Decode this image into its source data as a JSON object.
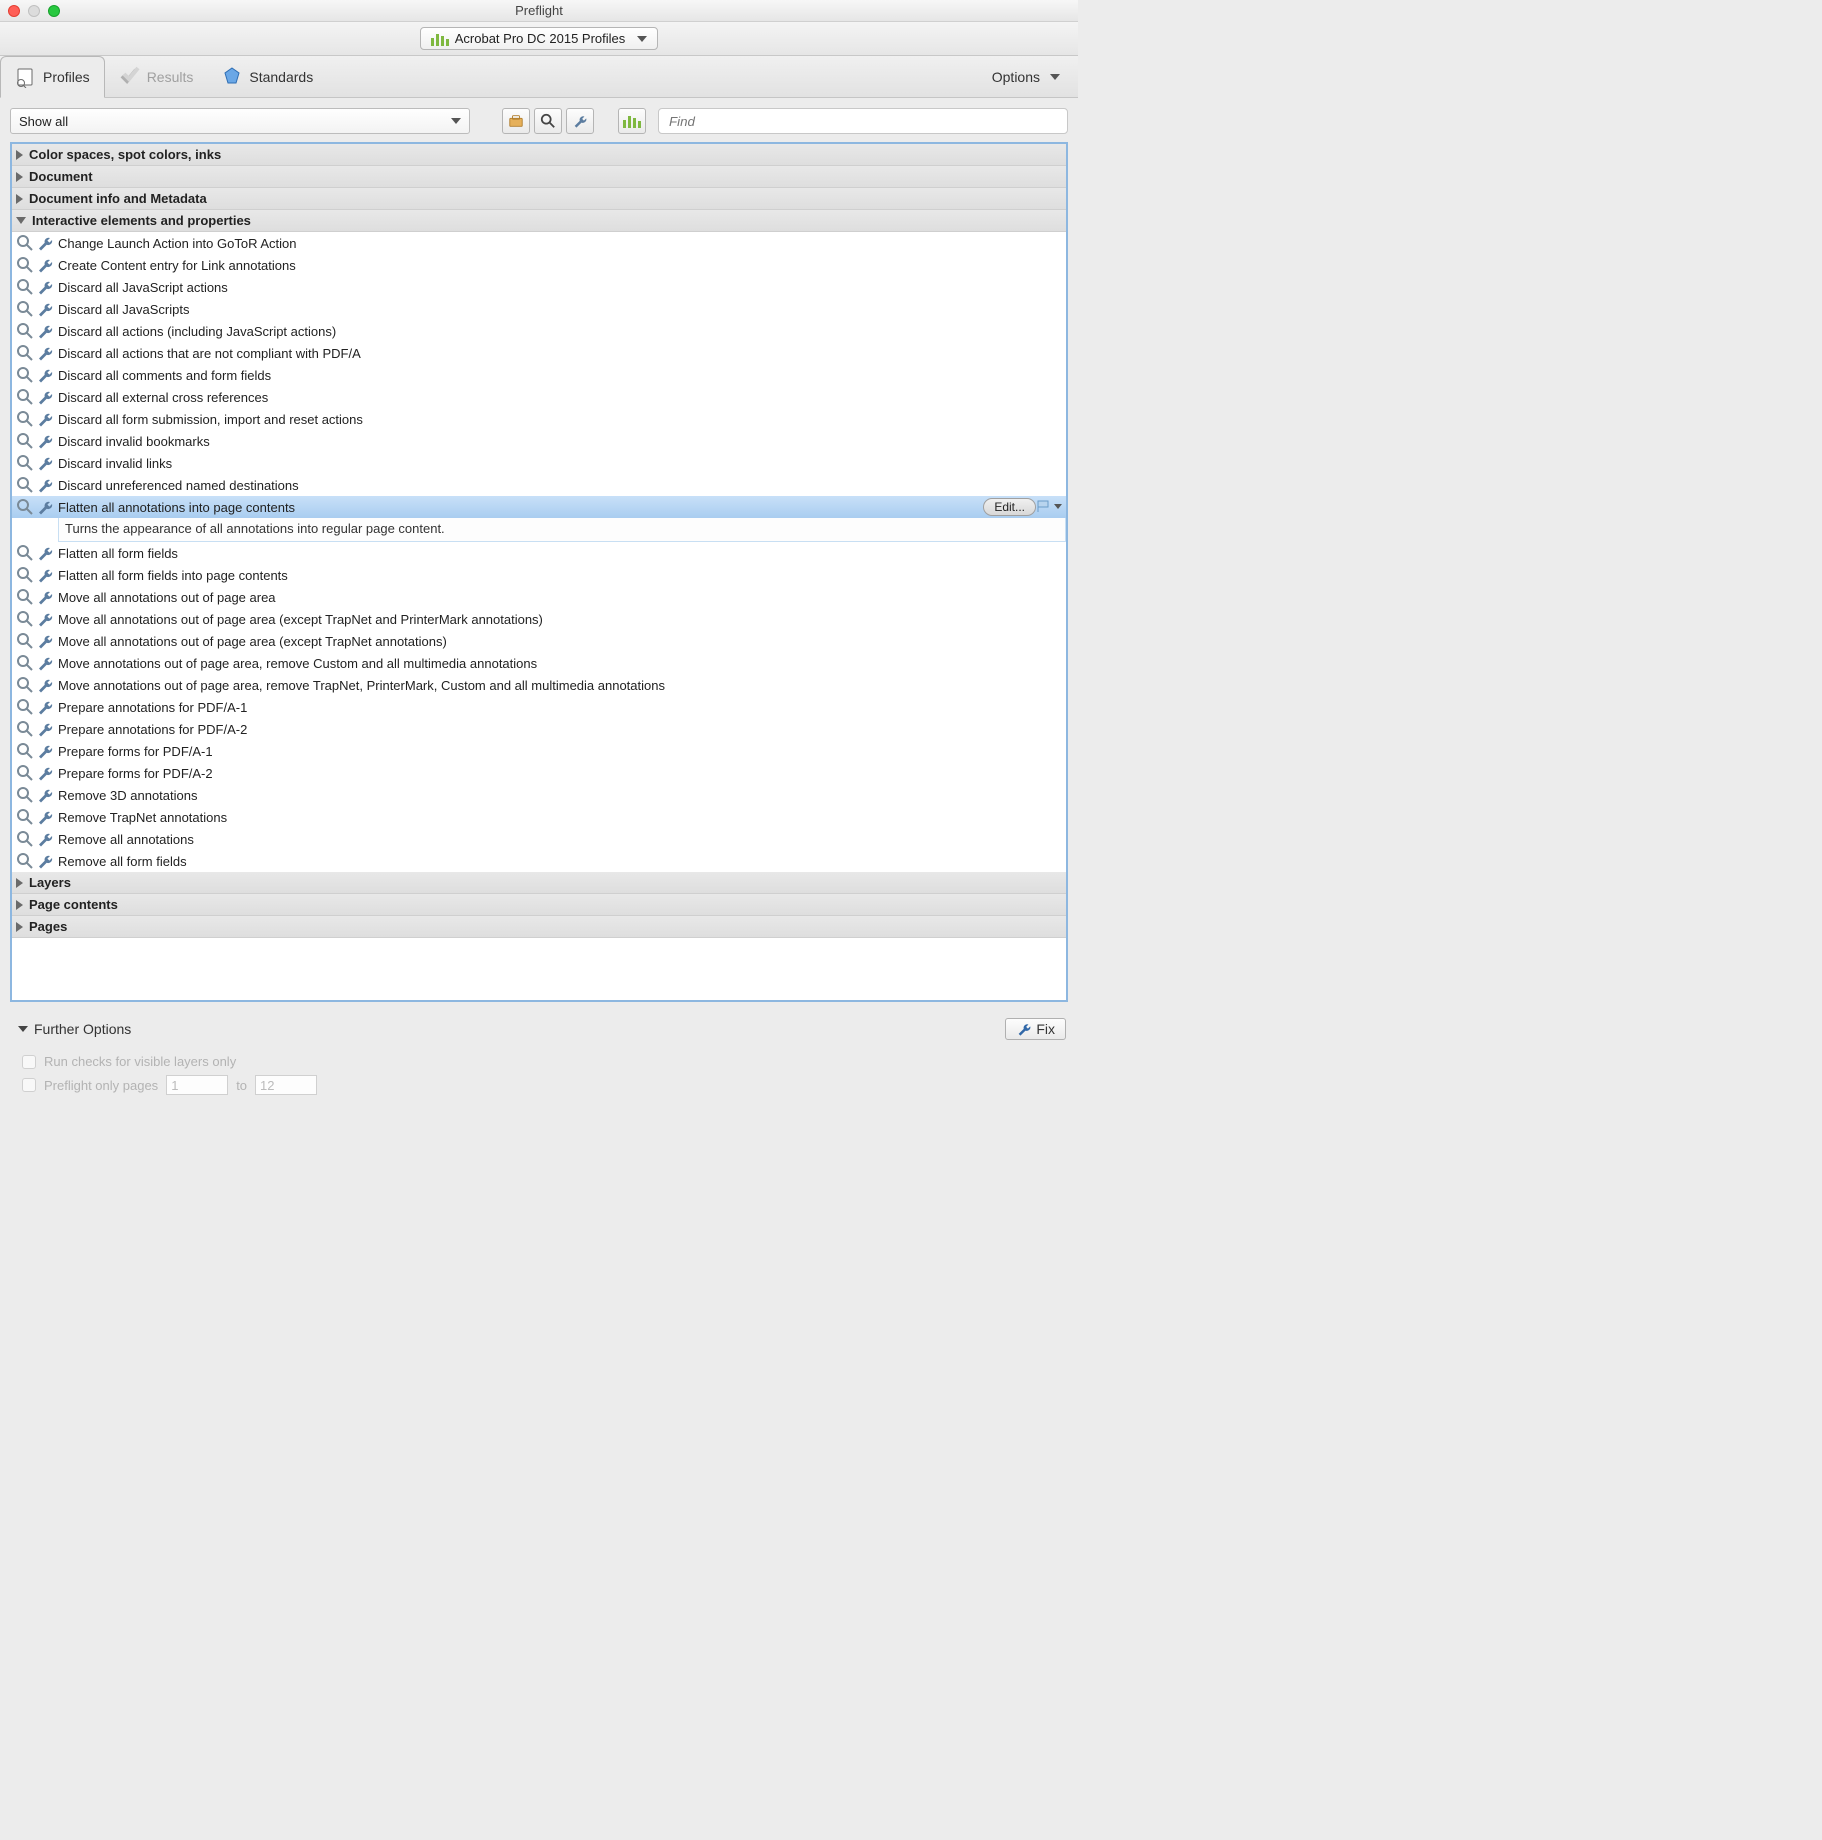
{
  "window": {
    "title": "Preflight"
  },
  "profileSelector": {
    "label": "Acrobat Pro DC 2015 Profiles"
  },
  "tabs": {
    "profiles": "Profiles",
    "results": "Results",
    "standards": "Standards"
  },
  "optionsMenu": "Options",
  "filter": {
    "showAll": "Show all",
    "findPlaceholder": "Find"
  },
  "categories": [
    {
      "label": "Color spaces, spot colors, inks",
      "expanded": false
    },
    {
      "label": "Document",
      "expanded": false
    },
    {
      "label": "Document info and Metadata",
      "expanded": false
    },
    {
      "label": "Interactive elements and properties",
      "expanded": true
    },
    {
      "label": "Layers",
      "expanded": false
    },
    {
      "label": "Page contents",
      "expanded": false
    },
    {
      "label": "Pages",
      "expanded": false
    }
  ],
  "items": [
    "Change Launch Action into GoToR Action",
    "Create Content entry for Link annotations",
    "Discard all JavaScript actions",
    "Discard all JavaScripts",
    "Discard all actions (including JavaScript actions)",
    "Discard all actions that are not compliant with PDF/A",
    "Discard all comments and form fields",
    "Discard all external cross references",
    "Discard all form submission, import and reset actions",
    "Discard invalid bookmarks",
    "Discard invalid links",
    "Discard unreferenced named destinations",
    "Flatten all annotations into page contents",
    "Flatten all form fields",
    "Flatten all form fields into page contents",
    "Move all annotations out of page area",
    "Move all annotations out of page area (except TrapNet and PrinterMark annotations)",
    "Move all annotations out of page area (except TrapNet annotations)",
    "Move annotations out of page area, remove Custom and all multimedia annotations",
    "Move annotations out of page area, remove TrapNet, PrinterMark, Custom and all multimedia annotations",
    "Prepare annotations for PDF/A-1",
    "Prepare annotations for PDF/A-2",
    "Prepare forms for PDF/A-1",
    "Prepare forms for PDF/A-2",
    "Remove 3D annotations",
    "Remove TrapNet annotations",
    "Remove all annotations",
    "Remove all form fields"
  ],
  "selectedIndex": 12,
  "selectedDescription": "Turns the appearance of all annotations into regular page content.",
  "editLabel": "Edit...",
  "footer": {
    "further": "Further Options",
    "fix": "Fix",
    "visibleLayers": "Run checks for visible layers only",
    "preflightPages": "Preflight only pages",
    "pageFrom": "1",
    "to": "to",
    "pageTo": "12"
  }
}
